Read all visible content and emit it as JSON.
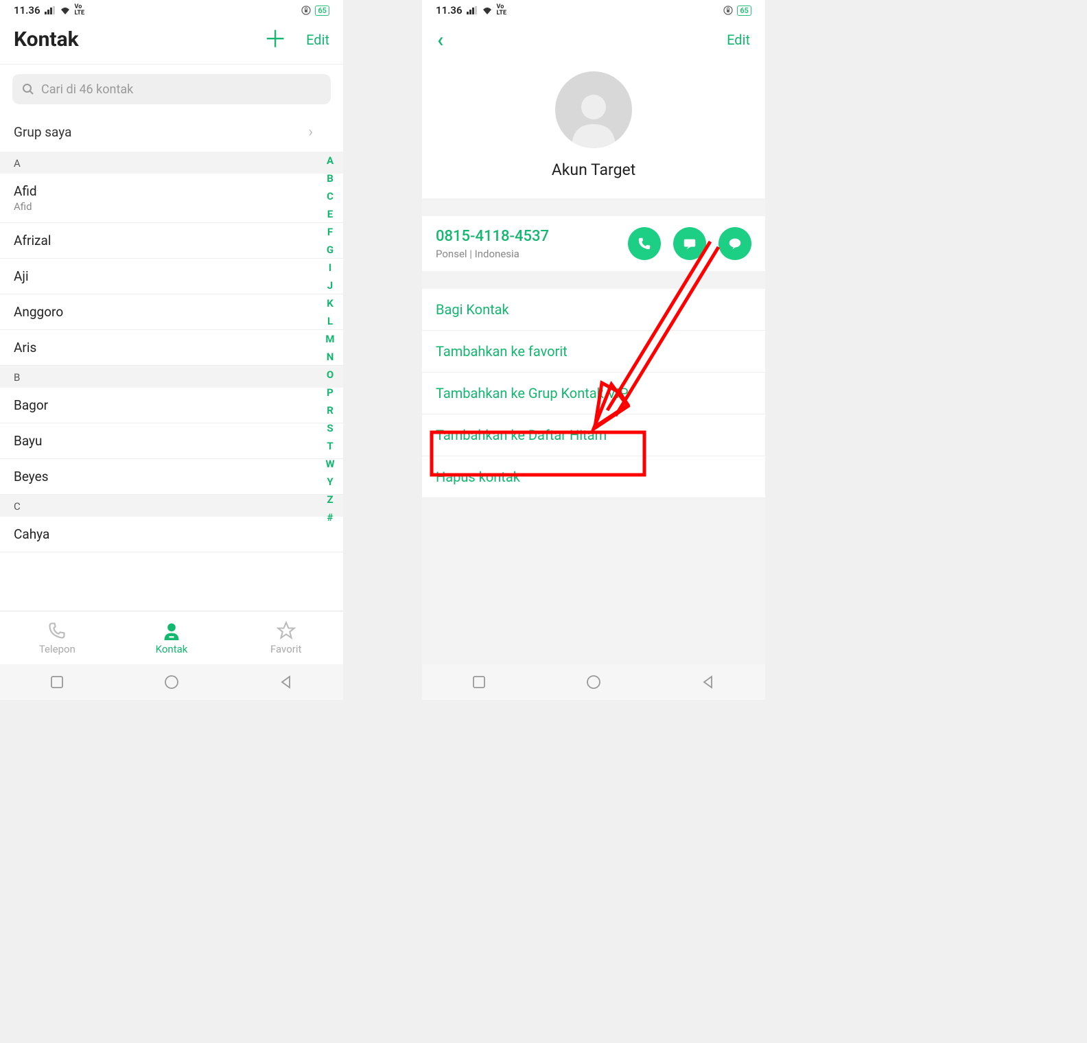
{
  "status": {
    "time": "11.36",
    "volte": "Vo\nLTE",
    "battery": "65"
  },
  "left": {
    "title": "Kontak",
    "edit": "Edit",
    "search_placeholder": "Cari di 46 kontak",
    "group_label": "Grup saya",
    "sections": [
      {
        "letter": "A",
        "contacts": [
          {
            "name": "Afid",
            "sub": "Afid"
          },
          {
            "name": "Afrizal"
          },
          {
            "name": "Aji"
          },
          {
            "name": "Anggoro"
          },
          {
            "name": "Aris"
          }
        ]
      },
      {
        "letter": "B",
        "contacts": [
          {
            "name": "Bagor"
          },
          {
            "name": "Bayu"
          },
          {
            "name": "Beyes"
          }
        ]
      },
      {
        "letter": "C",
        "contacts": [
          {
            "name": "Cahya"
          }
        ]
      }
    ],
    "index_letters": [
      "A",
      "B",
      "C",
      "E",
      "F",
      "G",
      "I",
      "J",
      "K",
      "L",
      "M",
      "N",
      "O",
      "P",
      "R",
      "S",
      "T",
      "W",
      "Y",
      "Z",
      "#"
    ],
    "tabs": {
      "phone": "Telepon",
      "contacts": "Kontak",
      "favorite": "Favorit"
    }
  },
  "right": {
    "edit": "Edit",
    "contact_name": "Akun Target",
    "phone_number": "0815-4118-4537",
    "phone_type": "Ponsel | Indonesia",
    "actions": [
      "Bagi Kontak",
      "Tambahkan ke favorit",
      "Tambahkan ke Grup Kontak VIP",
      "Tambahkan ke Daftar Hitam",
      "Hapus kontak"
    ]
  },
  "colors": {
    "accent": "#14b76f",
    "accent_bright": "#1dcf84",
    "annotation": "#ff0000"
  }
}
